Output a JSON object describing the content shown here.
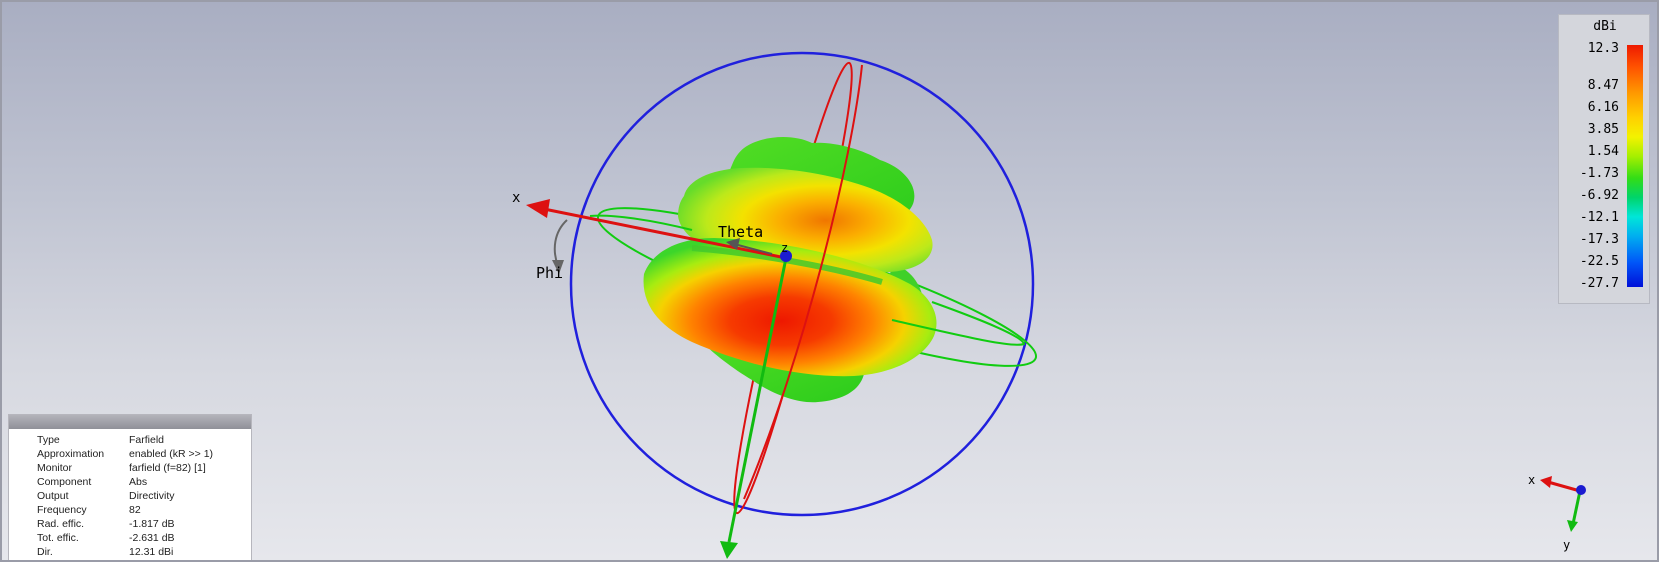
{
  "scene": {
    "axis_labels": {
      "x": "x",
      "z": "z"
    },
    "angle_labels": {
      "theta": "Theta",
      "phi": "Phi"
    }
  },
  "legend": {
    "unit": "dBi",
    "ticks": [
      "12.3",
      "8.47",
      "6.16",
      "3.85",
      "1.54",
      "-1.73",
      "-6.92",
      "-12.1",
      "-17.3",
      "-22.5",
      "-27.7"
    ]
  },
  "info": [
    {
      "label": "Type",
      "value": "Farfield"
    },
    {
      "label": "Approximation",
      "value": "enabled (kR >> 1)"
    },
    {
      "label": "Monitor",
      "value": "farfield (f=82) [1]"
    },
    {
      "label": "Component",
      "value": "Abs"
    },
    {
      "label": "Output",
      "value": "Directivity"
    },
    {
      "label": "Frequency",
      "value": "82"
    },
    {
      "label": "Rad. effic.",
      "value": "-1.817 dB"
    },
    {
      "label": "Tot. effic.",
      "value": "-2.631 dB"
    },
    {
      "label": "Dir.",
      "value": "12.31 dBi"
    }
  ],
  "orientation": {
    "x": "x",
    "y": "y"
  },
  "colors": {
    "sphere_ring": "#2020dd",
    "theta_ring": "#dd1111",
    "phi_ring": "#11cc11",
    "x_axis": "#dd1111",
    "y_axis": "#11bb11",
    "z_axis": "#1b1bd0",
    "angle_arrows": "#666666"
  }
}
